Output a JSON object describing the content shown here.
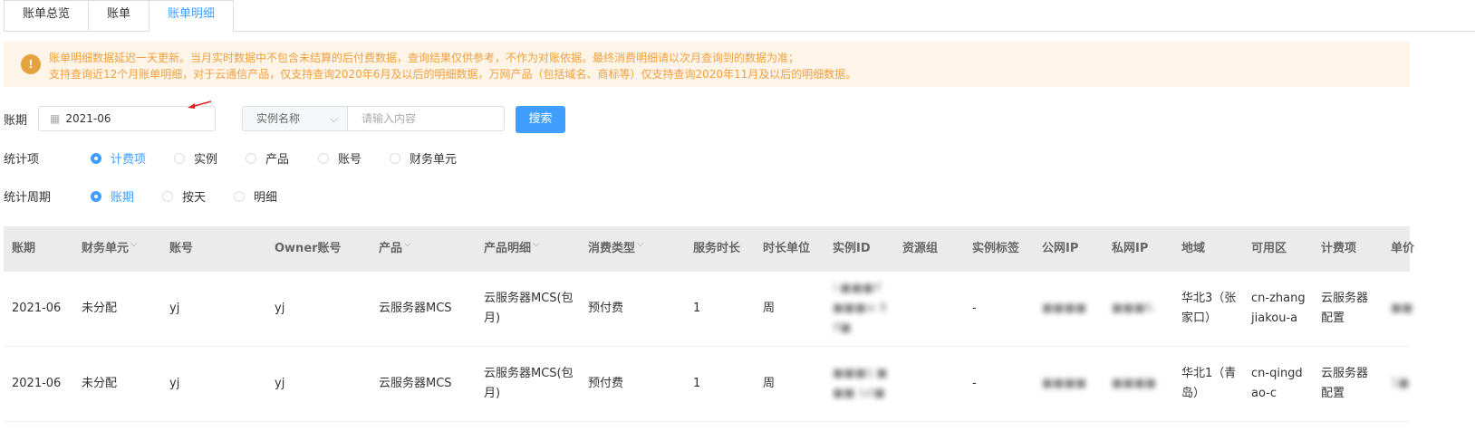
{
  "tabs": [
    "账单总览",
    "账单",
    "账单明细"
  ],
  "active_tab": 2,
  "notice": {
    "line1": "账单明细数据延迟一天更新。当月实时数据中不包含未结算的后付费数据，查询结果仅供参考，不作为对账依据。最终消费明细请以次月查询到的数据为准；",
    "line2": "支持查询近12个月账单明细，对于云通信产品，仅支持查询2020年6月及以后的明细数据，万网产品（包括域名、商标等）仅支持查询2020年11月及以后的明细数据。"
  },
  "filters": {
    "period_label": "账期",
    "period_value": "2021-06",
    "select_value": "实例名称",
    "search_placeholder": "请输入内容",
    "search_button": "搜索",
    "stat_label": "统计项",
    "stat_options": [
      "计费项",
      "实例",
      "产品",
      "账号",
      "财务单元"
    ],
    "cycle_label": "统计周期",
    "cycle_options": [
      "账期",
      "按天",
      "明细"
    ]
  },
  "table": {
    "columns": [
      "账期",
      "财务单元",
      "账号",
      "Owner账号",
      "产品",
      "产品明细",
      "消费类型",
      "服务时长",
      "时长单位",
      "实例ID",
      "资源组",
      "实例标签",
      "公网IP",
      "私网IP",
      "地域",
      "可用区",
      "计费项",
      "单价"
    ],
    "rows": [
      [
        "2021-06",
        "未分配",
        "yj",
        "yj",
        "云服务器MCS",
        "云服务器MCS(包月)",
        "预付费",
        "1",
        "周",
        "i-■■■lf ■■■w 8lf■",
        "",
        "-",
        "■■■■",
        "■■■6.",
        "华北3（张家口）",
        "cn-zhangjiakou-a",
        "云服务器配置",
        "■■"
      ],
      [
        "2021-06",
        "未分配",
        "yj",
        "yj",
        "云服务器MCS",
        "云服务器MCS(包月)",
        "预付费",
        "1",
        "周",
        "■■■lj ■■■ iut■",
        "",
        "-",
        "■■■■",
        "■■■■",
        "华北1（青岛）",
        "cn-qingdao-c",
        "云服务器配置",
        "1■"
      ]
    ]
  }
}
